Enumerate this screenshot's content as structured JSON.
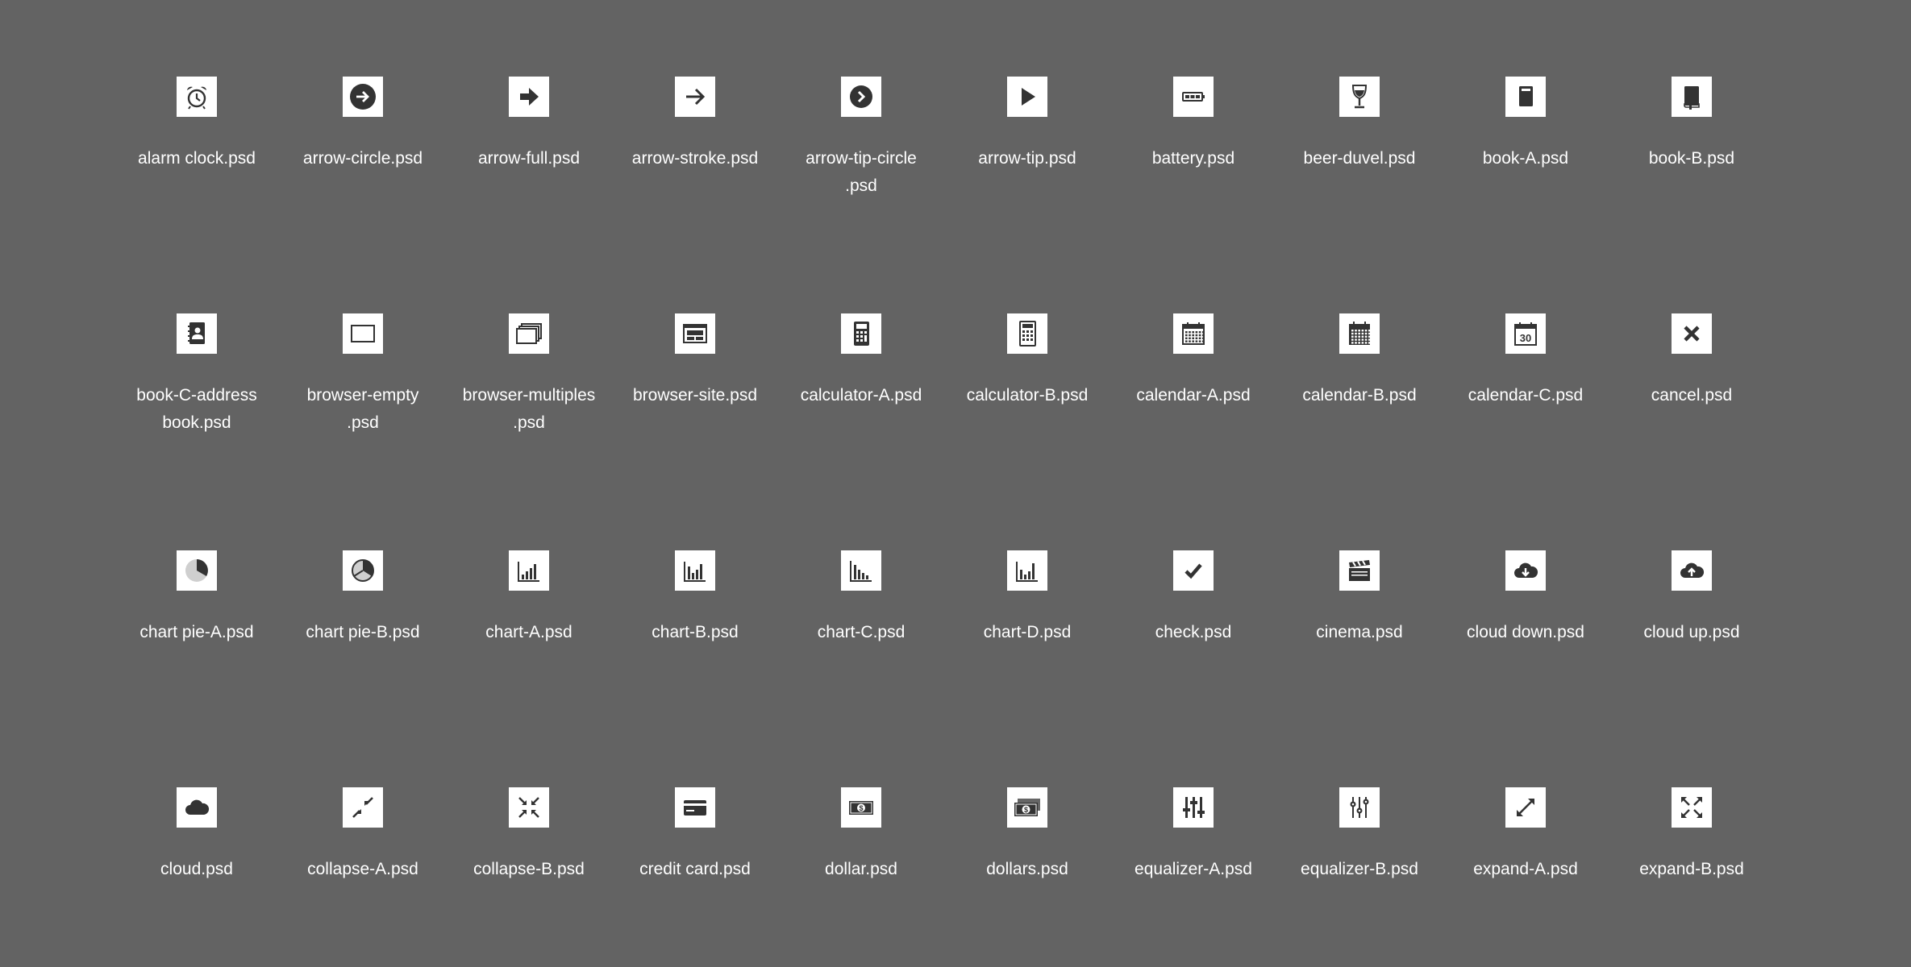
{
  "icon_color": "#333333",
  "tile_color": "#ffffff",
  "background": "#636363",
  "items": [
    {
      "label": "alarm clock.psd",
      "icon": "alarm-clock-icon"
    },
    {
      "label": "arrow-circle.psd",
      "icon": "arrow-circle-icon"
    },
    {
      "label": "arrow-full.psd",
      "icon": "arrow-full-icon"
    },
    {
      "label": "arrow-stroke.psd",
      "icon": "arrow-stroke-icon"
    },
    {
      "label": "arrow-tip-circle\n.psd",
      "icon": "arrow-tip-circle-icon"
    },
    {
      "label": "arrow-tip.psd",
      "icon": "arrow-tip-icon"
    },
    {
      "label": "battery.psd",
      "icon": "battery-icon"
    },
    {
      "label": "beer-duvel.psd",
      "icon": "beer-glass-icon"
    },
    {
      "label": "book-A.psd",
      "icon": "book-a-icon"
    },
    {
      "label": "book-B.psd",
      "icon": "book-b-icon"
    },
    {
      "label": "book-C-address\nbook.psd",
      "icon": "address-book-icon"
    },
    {
      "label": "browser-empty\n.psd",
      "icon": "browser-empty-icon"
    },
    {
      "label": "browser-multiples\n.psd",
      "icon": "browser-multiples-icon"
    },
    {
      "label": "browser-site.psd",
      "icon": "browser-site-icon"
    },
    {
      "label": "calculator-A.psd",
      "icon": "calculator-a-icon"
    },
    {
      "label": "calculator-B.psd",
      "icon": "calculator-b-icon"
    },
    {
      "label": "calendar-A.psd",
      "icon": "calendar-a-icon"
    },
    {
      "label": "calendar-B.psd",
      "icon": "calendar-b-icon"
    },
    {
      "label": "calendar-C.psd",
      "icon": "calendar-c-icon",
      "text": "30"
    },
    {
      "label": "cancel.psd",
      "icon": "cancel-icon"
    },
    {
      "label": "chart pie-A.psd",
      "icon": "chart-pie-a-icon"
    },
    {
      "label": "chart pie-B.psd",
      "icon": "chart-pie-b-icon"
    },
    {
      "label": "chart-A.psd",
      "icon": "chart-a-icon"
    },
    {
      "label": "chart-B.psd",
      "icon": "chart-b-icon"
    },
    {
      "label": "chart-C.psd",
      "icon": "chart-c-icon"
    },
    {
      "label": "chart-D.psd",
      "icon": "chart-d-icon"
    },
    {
      "label": "check.psd",
      "icon": "check-icon"
    },
    {
      "label": "cinema.psd",
      "icon": "clapperboard-icon"
    },
    {
      "label": "cloud down.psd",
      "icon": "cloud-down-icon"
    },
    {
      "label": "cloud up.psd",
      "icon": "cloud-up-icon"
    },
    {
      "label": "cloud.psd",
      "icon": "cloud-icon"
    },
    {
      "label": "collapse-A.psd",
      "icon": "collapse-a-icon"
    },
    {
      "label": "collapse-B.psd",
      "icon": "collapse-b-icon"
    },
    {
      "label": "credit card.psd",
      "icon": "credit-card-icon"
    },
    {
      "label": "dollar.psd",
      "icon": "dollar-bill-icon",
      "text": "$"
    },
    {
      "label": "dollars.psd",
      "icon": "dollar-bills-icon",
      "text": "$"
    },
    {
      "label": "equalizer-A.psd",
      "icon": "equalizer-a-icon"
    },
    {
      "label": "equalizer-B.psd",
      "icon": "equalizer-b-icon"
    },
    {
      "label": "expand-A.psd",
      "icon": "expand-a-icon"
    },
    {
      "label": "expand-B.psd",
      "icon": "expand-b-icon"
    }
  ]
}
